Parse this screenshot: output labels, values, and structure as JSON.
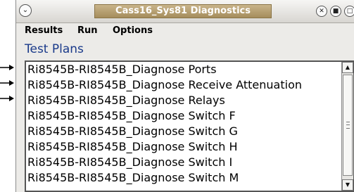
{
  "window": {
    "title": "Cass16_Sys81 Diagnostics",
    "menu_button_icon": "chevron-down-icon",
    "controls": [
      "close-icon",
      "minimize-icon",
      "maximize-icon"
    ]
  },
  "menubar": {
    "items": [
      "Results",
      "Run",
      "Options"
    ]
  },
  "section_label": "Test Plans",
  "test_plans": [
    "Ri8545B-RI8545B_Diagnose Ports",
    "Ri8545B-RI8545B_Diagnose Receive Attenuation",
    "Ri8545B-RI8545B_Diagnose Relays",
    "Ri8545B-RI8545B_Diagnose Switch F",
    "Ri8545B-RI8545B_Diagnose Switch G",
    "Ri8545B-RI8545B_Diagnose Switch H",
    "Ri8545B-RI8545B_Diagnose Switch I",
    "Ri8545B-RI8545B_Diagnose Switch M"
  ],
  "annotation_arrows": {
    "icon": "arrow-right-icon",
    "target_items": [
      "Ri8545B-RI8545B_Diagnose Ports",
      "Ri8545B-RI8545B_Diagnose Receive Attenuation",
      "Ri8545B-RI8545B_Diagnose Relays"
    ]
  },
  "colors": {
    "title_bar": "#a58d5c",
    "section_label": "#1a3a8a"
  }
}
